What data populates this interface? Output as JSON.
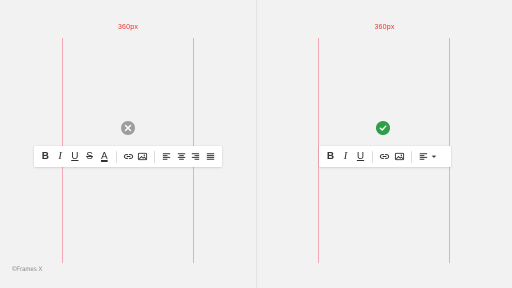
{
  "left": {
    "width_label": "360px",
    "status_icon": "close-icon",
    "tools": [
      {
        "id": "bold",
        "glyph": "B"
      },
      {
        "id": "italic",
        "glyph": "I"
      },
      {
        "id": "underline",
        "glyph": "U"
      },
      {
        "id": "strikethrough",
        "glyph": "S"
      },
      {
        "id": "text-color",
        "glyph": "A"
      }
    ]
  },
  "right": {
    "width_label": "360px",
    "status_icon": "check-icon",
    "tools": [
      {
        "id": "bold",
        "glyph": "B"
      },
      {
        "id": "italic",
        "glyph": "I"
      },
      {
        "id": "underline",
        "glyph": "U"
      }
    ]
  },
  "colors": {
    "guide": "#f4aab6",
    "width_label": "#e53935",
    "status_bad": "#9e9e9e",
    "status_good": "#2e9e4a"
  },
  "footer": {
    "copyright": "©Frames X"
  }
}
